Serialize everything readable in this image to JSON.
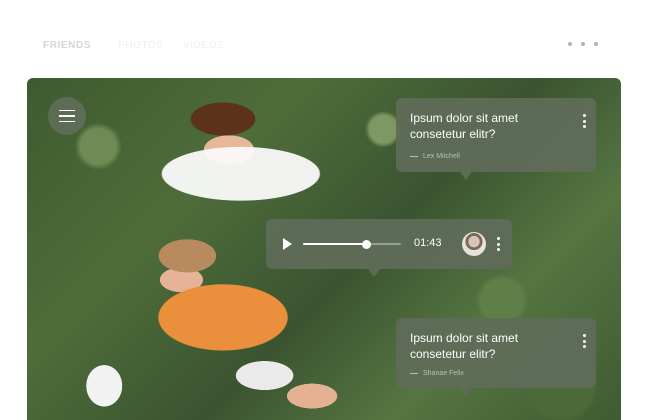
{
  "nav": {
    "tabs": [
      "FRIENDS",
      "PHOTOS",
      "VIDEOS"
    ],
    "more_icon": "more-horizontal-icon"
  },
  "photo": {
    "menu_icon": "hamburger-menu-icon"
  },
  "messages": [
    {
      "text": "Ipsum dolor sit amet consetetur elitr?",
      "author": "Lex Mitchell"
    },
    {
      "text": "Ipsum dolor sit amet consetetur elitr?",
      "author": "Shanae Felix"
    }
  ],
  "audio": {
    "time": "01:43",
    "progress": 0.64,
    "play_icon": "play-icon"
  },
  "colors": {
    "bubble": "#606c58",
    "nav_text": "#d2d5da"
  }
}
